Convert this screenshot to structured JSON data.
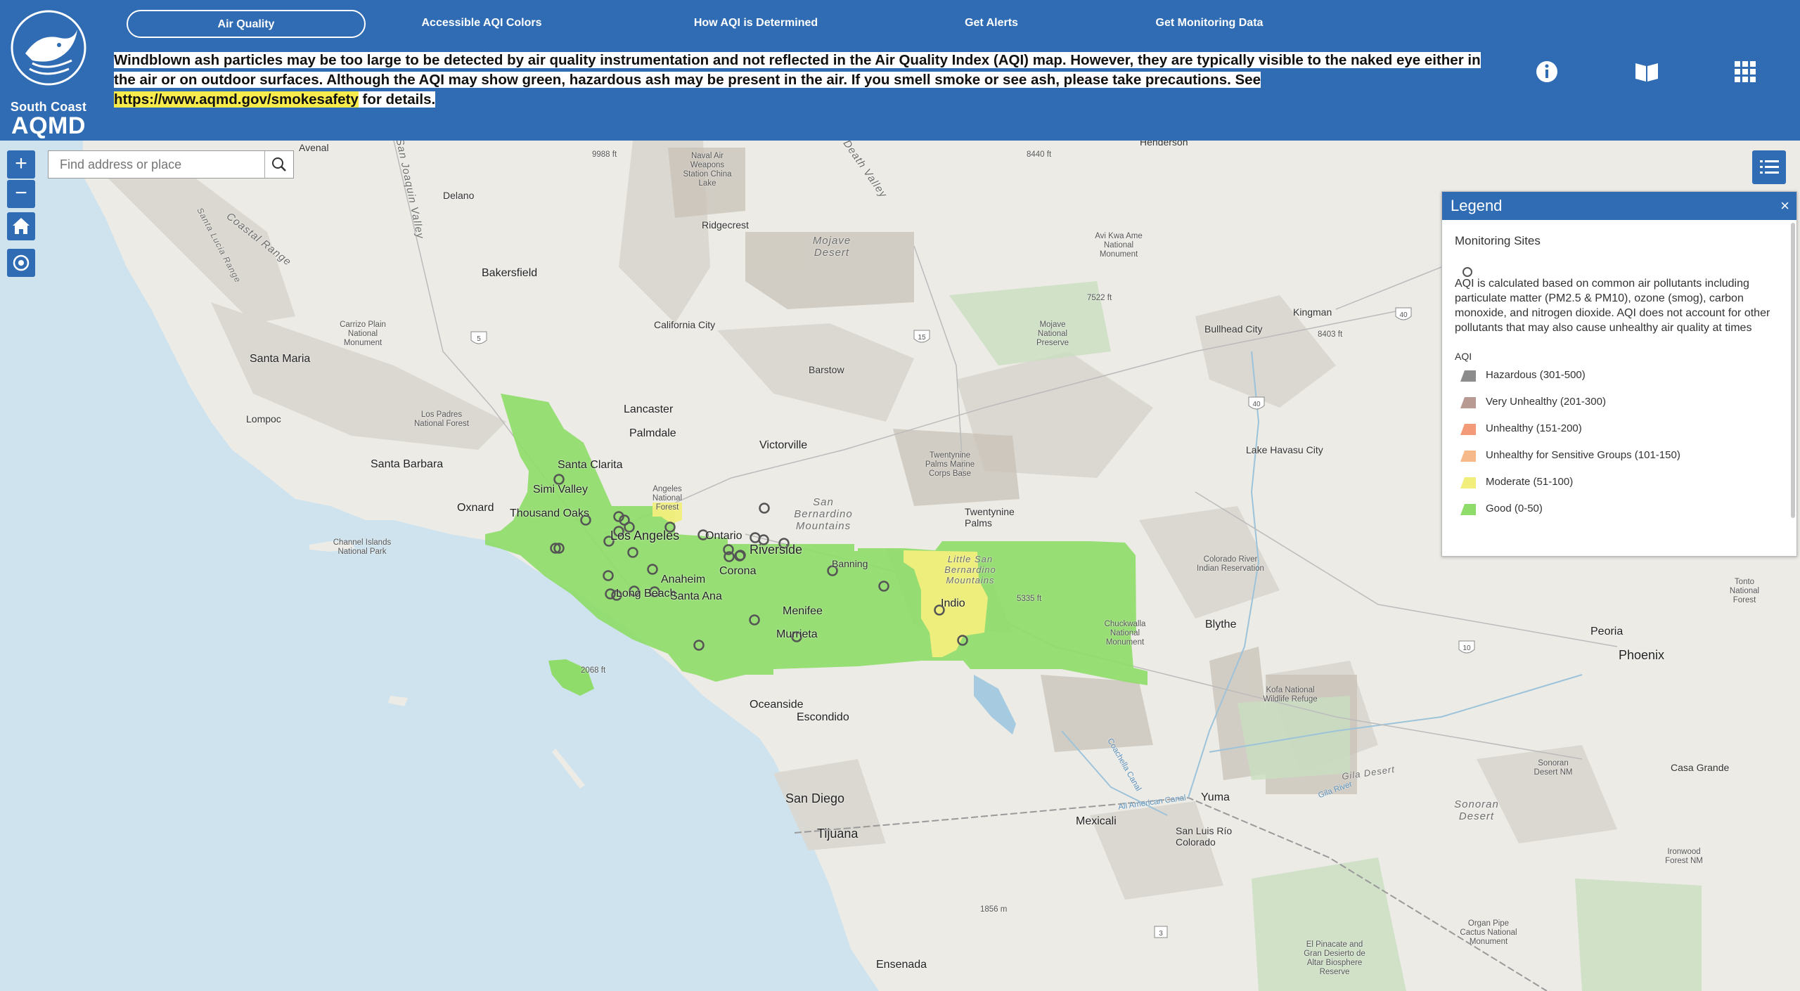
{
  "header": {
    "logo_line1": "South Coast",
    "logo_line2": "AQMD",
    "nav": [
      {
        "label": "Air Quality"
      },
      {
        "label": "Accessible AQI Colors"
      },
      {
        "label": "How AQI is Determined"
      },
      {
        "label": "Get Alerts"
      },
      {
        "label": "Get Monitoring Data"
      }
    ],
    "notice_text": "Windblown ash particles may be too large to be detected by air quality instrumentation and not reflected in the Air Quality Index (AQI) map. However, they are typically visible to the naked eye either in the air or on outdoor surfaces. Although the AQI may show green, hazardous ash may be present in the air. If you smell smoke or see ash, please take precautions. See ",
    "notice_link": "https://www.aqmd.gov/smokesafety",
    "notice_tail": " for details.",
    "icons": [
      "info-icon",
      "book-icon",
      "grid-icon"
    ]
  },
  "search": {
    "placeholder": "Find address or place"
  },
  "controls": [
    "zoom-in-icon",
    "zoom-out-icon",
    "home-icon",
    "locate-icon",
    "layer-list-icon"
  ],
  "legend": {
    "title": "Legend",
    "close": "×",
    "monitoring_title": "Monitoring Sites",
    "description": "AQI is calculated based on common air pollutants including particulate matter (PM2.5 & PM10), ozone (smog), carbon monoxide, and nitrogen dioxide. AQI does not account for other pollutants that may also cause unhealthy air quality at times",
    "aqi_label": "AQI",
    "items": [
      {
        "label": "Hazardous (301-500)",
        "color": "#8c8c8c"
      },
      {
        "label": "Very Unhealthy (201-300)",
        "color": "#b89a92"
      },
      {
        "label": "Unhealthy (151-200)",
        "color": "#f39a78"
      },
      {
        "label": "Unhealthy for Sensitive Groups (101-150)",
        "color": "#f6b98a"
      },
      {
        "label": "Moderate (51-100)",
        "color": "#f1ee7c"
      },
      {
        "label": "Good (0-50)",
        "color": "#8fdc6a"
      }
    ]
  },
  "map": {
    "colors": {
      "ocean": "#cfe3ee",
      "land": "#ecebe6",
      "good": "#8fdc6a",
      "moderate": "#f1ee7c",
      "mountain": "#d6d3cb"
    },
    "labels": [
      {
        "t": "Avenal"
      },
      {
        "t": "Delano"
      },
      {
        "t": "Bakersfield"
      },
      {
        "t": "Santa Maria"
      },
      {
        "t": "Lompoc"
      },
      {
        "t": "Santa Barbara"
      },
      {
        "t": "Oxnard"
      },
      {
        "t": "Thousand Oaks"
      },
      {
        "t": "Simi Valley"
      },
      {
        "t": "Santa Clarita"
      },
      {
        "t": "Lancaster"
      },
      {
        "t": "Palmdale"
      },
      {
        "t": "Victorville"
      },
      {
        "t": "Barstow"
      },
      {
        "t": "California City"
      },
      {
        "t": "Ridgecrest"
      },
      {
        "t": "Los Angeles"
      },
      {
        "t": "Long Beach"
      },
      {
        "t": "Anaheim"
      },
      {
        "t": "Santa Ana"
      },
      {
        "t": "Corona"
      },
      {
        "t": "Ontario"
      },
      {
        "t": "Riverside"
      },
      {
        "t": "Banning"
      },
      {
        "t": "Menifee"
      },
      {
        "t": "Murrieta"
      },
      {
        "t": "Indio"
      },
      {
        "t": "Twentynine Palms"
      },
      {
        "t": "Oceanside"
      },
      {
        "t": "Escondido"
      },
      {
        "t": "San Diego"
      },
      {
        "t": "Tijuana"
      },
      {
        "t": "Mexicali"
      },
      {
        "t": "Ensenada"
      },
      {
        "t": "Yuma"
      },
      {
        "t": "San Luis Río Colorado"
      },
      {
        "t": "Blythe"
      },
      {
        "t": "Phoenix"
      },
      {
        "t": "Peoria"
      },
      {
        "t": "Casa Grande"
      },
      {
        "t": "Kingman"
      },
      {
        "t": "Bullhead City"
      },
      {
        "t": "Lake Havasu City"
      },
      {
        "t": "Henderson"
      }
    ],
    "small_labels": [
      "Naval Air Weapons Station China Lake",
      "Carrizo Plain National Monument",
      "Los Padres National Forest",
      "Channel Islands National Park",
      "Mojave National Preserve",
      "Avi Kwa Ame National Monument",
      "Twentynine Palms Marine Corps Base",
      "Colorado River Indian Reservation",
      "Chuckwalla National Monument",
      "Kofa National Wildlife Refuge",
      "Sonoran Desert NM",
      "Ironwood Forest NM",
      "Organ Pipe Cactus National Monument",
      "El Pinacate and Gran Desierto de Altar Biosphere Reserve",
      "Tonto National Forest",
      "Angeles National Forest"
    ],
    "regions": [
      "Mojave Desert",
      "Coastal Range",
      "San Bernardino Mountains",
      "Little San Bernardino Mountains",
      "Sonoran Desert",
      "Death Valley",
      "San Joaquin Valley",
      "Santa Lucia Range"
    ],
    "elevations": [
      "9988 ft",
      "8440 ft",
      "7522 ft",
      "8403 ft",
      "5335 ft",
      "2068 ft",
      "1856 m"
    ],
    "roads": [
      "5",
      "15",
      "40",
      "40",
      "10",
      "3"
    ],
    "water": [
      "Coachella Canal",
      "All American Canal",
      "Gila River",
      "Gila Desert"
    ]
  }
}
